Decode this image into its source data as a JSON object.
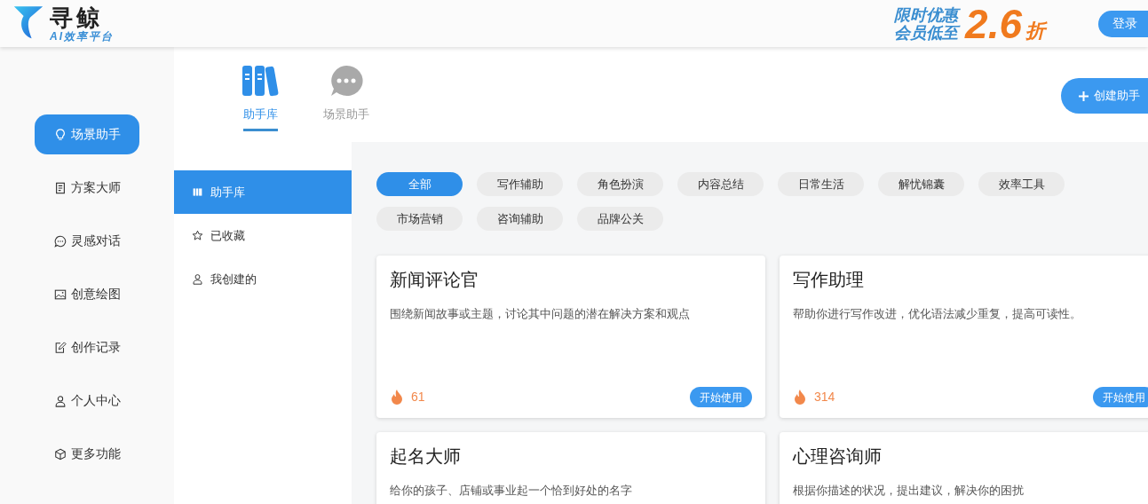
{
  "header": {
    "logo_name": "寻鲸",
    "logo_tagline": "AI效率平台",
    "promo_line_1": "限时优惠",
    "promo_line_2": "会员低至",
    "promo_number": "2.6",
    "promo_unit": "折",
    "login": "登录"
  },
  "sidebar": {
    "items": [
      {
        "label": "场景助手",
        "kind": "bulb",
        "selected": true
      },
      {
        "label": "方案大师",
        "kind": "doc",
        "selected": false
      },
      {
        "label": "灵感对话",
        "kind": "chat",
        "selected": false
      },
      {
        "label": "创意绘图",
        "kind": "image",
        "selected": false
      },
      {
        "label": "创作记录",
        "kind": "edit",
        "selected": false
      },
      {
        "label": "个人中心",
        "kind": "user",
        "selected": false
      },
      {
        "label": "更多功能",
        "kind": "cube",
        "selected": false
      }
    ]
  },
  "top_tabs": [
    {
      "label": "助手库",
      "kind": "books",
      "selected": true
    },
    {
      "label": "场景助手",
      "kind": "bubble",
      "selected": false
    }
  ],
  "create_button": "创建助手",
  "sub_nav": [
    {
      "label": "助手库",
      "kind": "book",
      "selected": true
    },
    {
      "label": "已收藏",
      "kind": "star",
      "selected": false
    },
    {
      "label": "我创建的",
      "kind": "user",
      "selected": false
    }
  ],
  "categories": [
    {
      "label": "全部",
      "selected": true
    },
    {
      "label": "写作辅助",
      "selected": false
    },
    {
      "label": "角色扮演",
      "selected": false
    },
    {
      "label": "内容总结",
      "selected": false
    },
    {
      "label": "日常生活",
      "selected": false
    },
    {
      "label": "解忧锦囊",
      "selected": false
    },
    {
      "label": "效率工具",
      "selected": false
    },
    {
      "label": "市场营销",
      "selected": false
    },
    {
      "label": "咨询辅助",
      "selected": false
    },
    {
      "label": "品牌公关",
      "selected": false
    }
  ],
  "cards": [
    {
      "title": "新闻评论官",
      "description": "围绕新闻故事或主题，讨论其中问题的潜在解决方案和观点",
      "count": "61",
      "button": "开始使用"
    },
    {
      "title": "写作助理",
      "description": "帮助你进行写作改进，优化语法减少重复，提高可读性。",
      "count": "314",
      "button": "开始使用"
    },
    {
      "title": "起名大师",
      "description": "给你的孩子、店铺或事业起一个恰到好处的名字"
    },
    {
      "title": "心理咨询师",
      "description": "根据你描述的状况，提出建议，解决你的困扰"
    }
  ]
}
